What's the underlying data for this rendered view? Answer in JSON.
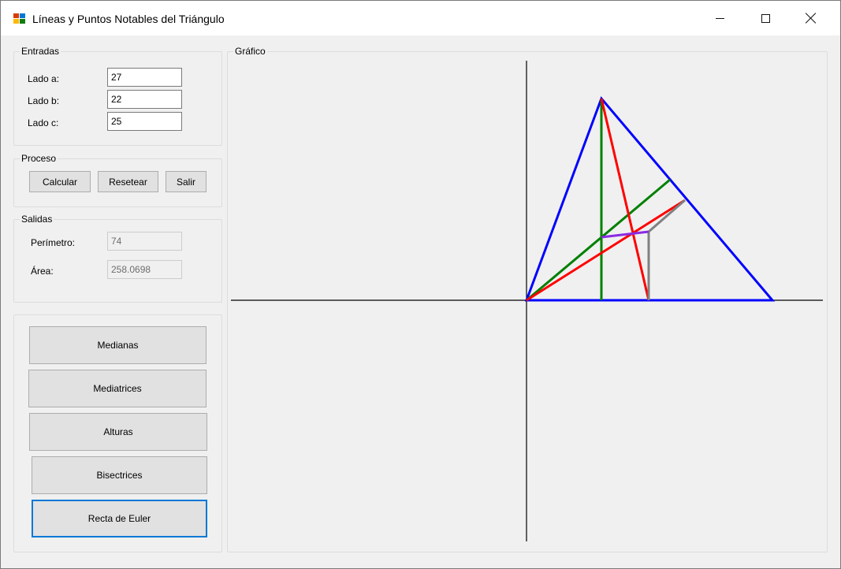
{
  "window": {
    "title": "Líneas y Puntos Notables del Triángulo"
  },
  "inputs": {
    "group_label": "Entradas",
    "lado_a": {
      "label": "Lado a:",
      "value": "27"
    },
    "lado_b": {
      "label": "Lado b:",
      "value": "22"
    },
    "lado_c": {
      "label": "Lado c:",
      "value": "25"
    }
  },
  "process": {
    "group_label": "Proceso",
    "calcular": "Calcular",
    "resetear": "Resetear",
    "salir": "Salir"
  },
  "outputs": {
    "group_label": "Salidas",
    "perimetro": {
      "label": "Perímetro:",
      "value": "74"
    },
    "area": {
      "label": "Área:",
      "value": "258.0698"
    }
  },
  "actions": {
    "medianas": "Medianas",
    "mediatrices": "Mediatrices",
    "alturas": "Alturas",
    "bisectrices": "Bisectrices",
    "euler": "Recta de Euler"
  },
  "graph": {
    "group_label": "Gráfico",
    "colors": {
      "axes": "#000000",
      "triangle": "#0000ff",
      "height": "#008000",
      "median": "#008000",
      "line_red": "#ff0000",
      "gray": "#808080",
      "euler": "#8a2be2"
    }
  }
}
